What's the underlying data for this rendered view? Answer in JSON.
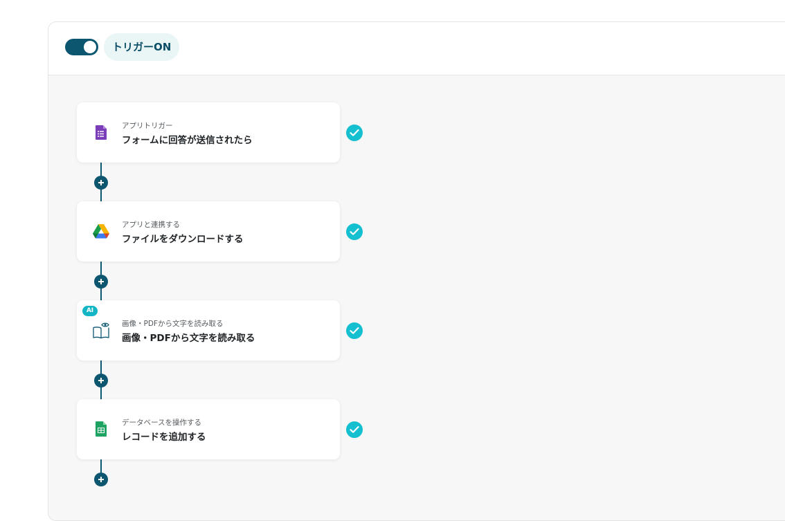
{
  "header": {
    "toggle_state": "on",
    "trigger_label": "トリガーON"
  },
  "colors": {
    "primary": "#0c5670",
    "check": "#14bfd0",
    "ai_badge": "#12b5c6",
    "forms": "#7a3fb8",
    "sheets": "#1ea362"
  },
  "steps": [
    {
      "icon": "google-forms-icon",
      "subtitle": "アプリトリガー",
      "title": "フォームに回答が送信されたら",
      "completed": true
    },
    {
      "icon": "google-drive-icon",
      "subtitle": "アプリと連携する",
      "title": "ファイルをダウンロードする",
      "completed": true
    },
    {
      "icon": "ocr-book-icon",
      "badge": "AI",
      "subtitle": "画像・PDFから文字を読み取る",
      "title": "画像・PDFから文字を読み取る",
      "completed": true
    },
    {
      "icon": "google-sheets-icon",
      "subtitle": "データベースを操作する",
      "title": "レコードを追加する",
      "completed": true
    }
  ]
}
